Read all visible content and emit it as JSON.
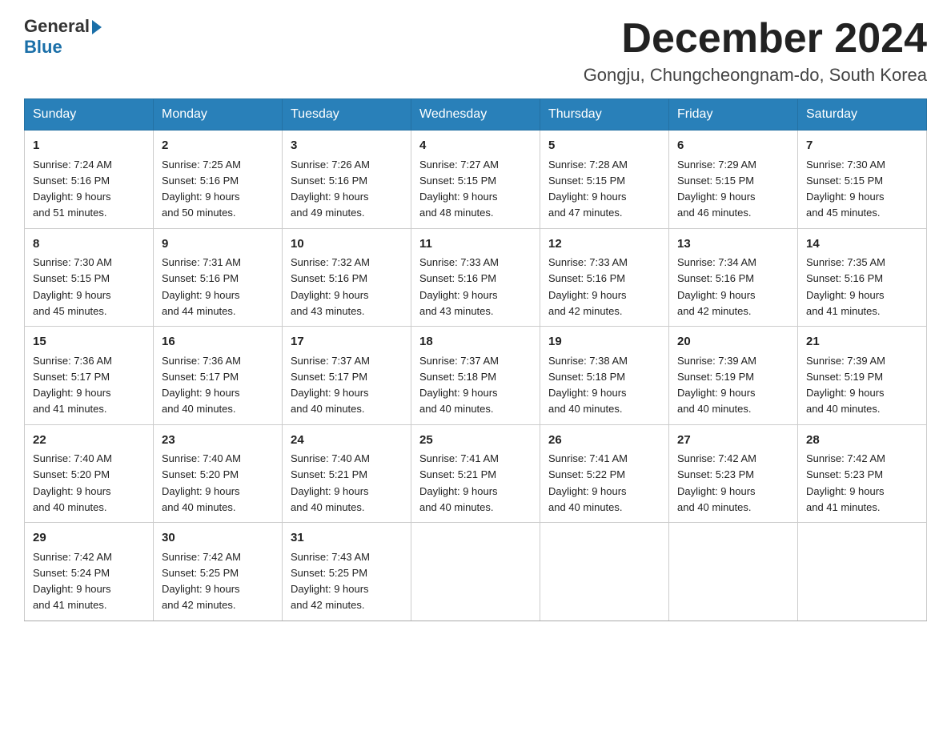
{
  "header": {
    "logo_general": "General",
    "logo_blue": "Blue",
    "month_title": "December 2024",
    "location": "Gongju, Chungcheongnam-do, South Korea"
  },
  "days_of_week": [
    "Sunday",
    "Monday",
    "Tuesday",
    "Wednesday",
    "Thursday",
    "Friday",
    "Saturday"
  ],
  "weeks": [
    [
      {
        "day": "1",
        "sunrise": "7:24 AM",
        "sunset": "5:16 PM",
        "daylight": "9 hours and 51 minutes."
      },
      {
        "day": "2",
        "sunrise": "7:25 AM",
        "sunset": "5:16 PM",
        "daylight": "9 hours and 50 minutes."
      },
      {
        "day": "3",
        "sunrise": "7:26 AM",
        "sunset": "5:16 PM",
        "daylight": "9 hours and 49 minutes."
      },
      {
        "day": "4",
        "sunrise": "7:27 AM",
        "sunset": "5:15 PM",
        "daylight": "9 hours and 48 minutes."
      },
      {
        "day": "5",
        "sunrise": "7:28 AM",
        "sunset": "5:15 PM",
        "daylight": "9 hours and 47 minutes."
      },
      {
        "day": "6",
        "sunrise": "7:29 AM",
        "sunset": "5:15 PM",
        "daylight": "9 hours and 46 minutes."
      },
      {
        "day": "7",
        "sunrise": "7:30 AM",
        "sunset": "5:15 PM",
        "daylight": "9 hours and 45 minutes."
      }
    ],
    [
      {
        "day": "8",
        "sunrise": "7:30 AM",
        "sunset": "5:15 PM",
        "daylight": "9 hours and 45 minutes."
      },
      {
        "day": "9",
        "sunrise": "7:31 AM",
        "sunset": "5:16 PM",
        "daylight": "9 hours and 44 minutes."
      },
      {
        "day": "10",
        "sunrise": "7:32 AM",
        "sunset": "5:16 PM",
        "daylight": "9 hours and 43 minutes."
      },
      {
        "day": "11",
        "sunrise": "7:33 AM",
        "sunset": "5:16 PM",
        "daylight": "9 hours and 43 minutes."
      },
      {
        "day": "12",
        "sunrise": "7:33 AM",
        "sunset": "5:16 PM",
        "daylight": "9 hours and 42 minutes."
      },
      {
        "day": "13",
        "sunrise": "7:34 AM",
        "sunset": "5:16 PM",
        "daylight": "9 hours and 42 minutes."
      },
      {
        "day": "14",
        "sunrise": "7:35 AM",
        "sunset": "5:16 PM",
        "daylight": "9 hours and 41 minutes."
      }
    ],
    [
      {
        "day": "15",
        "sunrise": "7:36 AM",
        "sunset": "5:17 PM",
        "daylight": "9 hours and 41 minutes."
      },
      {
        "day": "16",
        "sunrise": "7:36 AM",
        "sunset": "5:17 PM",
        "daylight": "9 hours and 40 minutes."
      },
      {
        "day": "17",
        "sunrise": "7:37 AM",
        "sunset": "5:17 PM",
        "daylight": "9 hours and 40 minutes."
      },
      {
        "day": "18",
        "sunrise": "7:37 AM",
        "sunset": "5:18 PM",
        "daylight": "9 hours and 40 minutes."
      },
      {
        "day": "19",
        "sunrise": "7:38 AM",
        "sunset": "5:18 PM",
        "daylight": "9 hours and 40 minutes."
      },
      {
        "day": "20",
        "sunrise": "7:39 AM",
        "sunset": "5:19 PM",
        "daylight": "9 hours and 40 minutes."
      },
      {
        "day": "21",
        "sunrise": "7:39 AM",
        "sunset": "5:19 PM",
        "daylight": "9 hours and 40 minutes."
      }
    ],
    [
      {
        "day": "22",
        "sunrise": "7:40 AM",
        "sunset": "5:20 PM",
        "daylight": "9 hours and 40 minutes."
      },
      {
        "day": "23",
        "sunrise": "7:40 AM",
        "sunset": "5:20 PM",
        "daylight": "9 hours and 40 minutes."
      },
      {
        "day": "24",
        "sunrise": "7:40 AM",
        "sunset": "5:21 PM",
        "daylight": "9 hours and 40 minutes."
      },
      {
        "day": "25",
        "sunrise": "7:41 AM",
        "sunset": "5:21 PM",
        "daylight": "9 hours and 40 minutes."
      },
      {
        "day": "26",
        "sunrise": "7:41 AM",
        "sunset": "5:22 PM",
        "daylight": "9 hours and 40 minutes."
      },
      {
        "day": "27",
        "sunrise": "7:42 AM",
        "sunset": "5:23 PM",
        "daylight": "9 hours and 40 minutes."
      },
      {
        "day": "28",
        "sunrise": "7:42 AM",
        "sunset": "5:23 PM",
        "daylight": "9 hours and 41 minutes."
      }
    ],
    [
      {
        "day": "29",
        "sunrise": "7:42 AM",
        "sunset": "5:24 PM",
        "daylight": "9 hours and 41 minutes."
      },
      {
        "day": "30",
        "sunrise": "7:42 AM",
        "sunset": "5:25 PM",
        "daylight": "9 hours and 42 minutes."
      },
      {
        "day": "31",
        "sunrise": "7:43 AM",
        "sunset": "5:25 PM",
        "daylight": "9 hours and 42 minutes."
      },
      null,
      null,
      null,
      null
    ]
  ],
  "labels": {
    "sunrise": "Sunrise:",
    "sunset": "Sunset:",
    "daylight": "Daylight:"
  }
}
